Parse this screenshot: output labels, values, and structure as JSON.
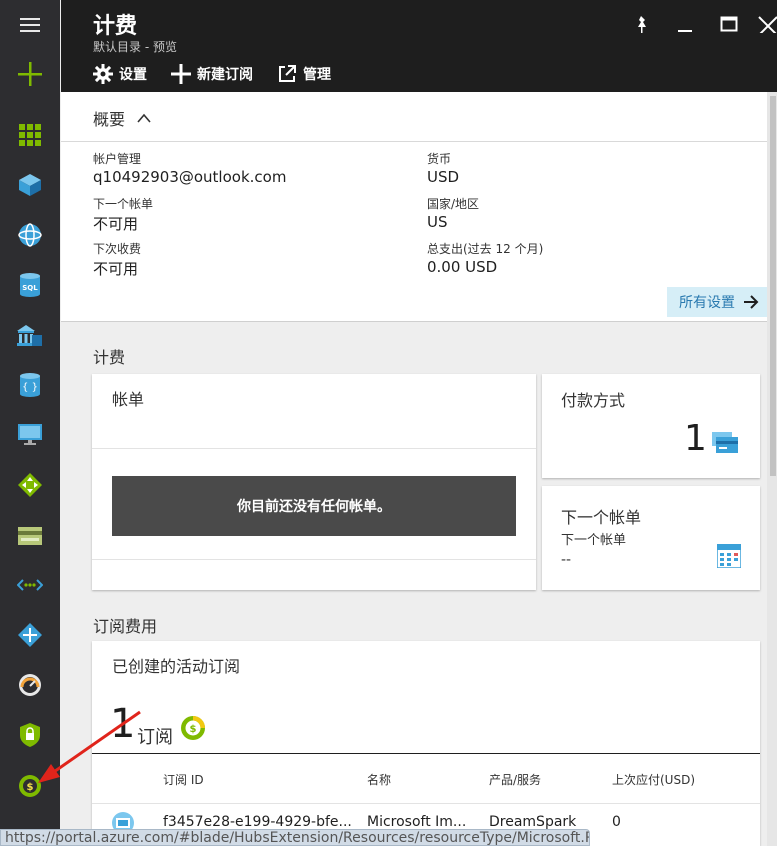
{
  "rail": {
    "items": [
      {
        "name": "hamburger-menu-icon"
      },
      {
        "name": "new-plus-icon"
      },
      {
        "name": "dashboard-grid-icon"
      },
      {
        "name": "resource-groups-cube-icon"
      },
      {
        "name": "app-services-globe-icon"
      },
      {
        "name": "sql-databases-icon"
      },
      {
        "name": "cloud-services-icon"
      },
      {
        "name": "documentdb-icon"
      },
      {
        "name": "virtual-machines-icon"
      },
      {
        "name": "load-balancer-icon"
      },
      {
        "name": "subscriptions-card-icon"
      },
      {
        "name": "virtual-network-icon"
      },
      {
        "name": "traffic-manager-icon"
      },
      {
        "name": "monitor-gauge-icon"
      },
      {
        "name": "security-lock-icon"
      },
      {
        "name": "billing-dollar-icon"
      }
    ],
    "colors": {
      "accent": "#7fba00",
      "icon_blue": "#3aa0d8"
    }
  },
  "blade": {
    "title": "计费",
    "subtitle": "默认目录 - 预览",
    "commands": {
      "settings": "设置",
      "new_subscription": "新建订阅",
      "manage": "管理"
    }
  },
  "essentials": {
    "toggle_label": "概要",
    "account_admin_label": "帐户管理",
    "account_admin_value": "q10492903@outlook.com",
    "next_invoice_label": "下一个帐单",
    "next_invoice_value": "不可用",
    "next_charge_label": "下次收费",
    "next_charge_value": "不可用",
    "currency_label": "货币",
    "currency_value": "USD",
    "country_label": "国家/地区",
    "country_value": "US",
    "total_spend_label": "总支出(过去 12 个月)",
    "total_spend_value": "0.00 USD",
    "all_settings": "所有设置"
  },
  "billing": {
    "section_title": "计费",
    "invoices_title": "帐单",
    "no_invoices_message": "你目前还没有任何帐单。",
    "payment_title": "付款方式",
    "payment_count": "1",
    "next_invoice_title": "下一个帐单",
    "next_invoice_sublabel": "下一个帐单",
    "next_invoice_value": "--"
  },
  "subscriptions": {
    "section_title": "订阅费用",
    "tile_title": "已创建的活动订阅",
    "count": "1",
    "count_label": "订阅",
    "columns": [
      "订阅 ID",
      "名称",
      "产品/服务",
      "上次应付(USD)"
    ],
    "rows": [
      {
        "id": "f3457e28-e199-4929-bfe...",
        "name": "Microsoft Im...",
        "offer": "DreamSpark",
        "last_due": "0"
      }
    ]
  },
  "status_bar": {
    "url": "https://portal.azure.com/#blade/HubsExtension/Resources/resourceType/Microsoft.R"
  }
}
